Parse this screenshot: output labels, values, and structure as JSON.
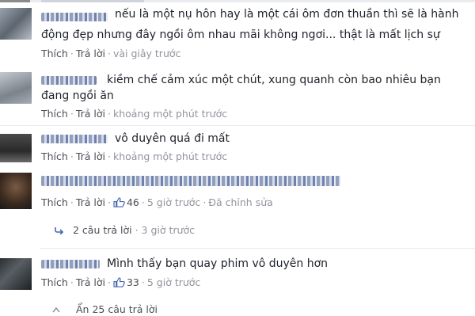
{
  "comments": [
    {
      "text_line1": "nếu là một nụ hôn hay là một cái ôm đơn thuần thì sẽ là hành",
      "text_line2": "động đẹp nhưng đây ngồi ôm nhau mãi không ngơi... thật là mất lịch sự",
      "like": "Thích",
      "reply": "Trả lời",
      "time": "vài giây trước"
    },
    {
      "text_line1": "kiềm chế cảm xúc một chút, xung quanh còn bao nhiêu bạn",
      "text_line2": "đang ngồi ăn",
      "like": "Thích",
      "reply": "Trả lời",
      "time": "khoảng một phút trước"
    },
    {
      "text_line1": "vô duyên quá đi mất",
      "like": "Thích",
      "reply": "Trả lời",
      "time": "khoảng một phút trước"
    },
    {
      "like": "Thích",
      "reply": "Trả lời",
      "likes": "46",
      "time": "5 giờ trước",
      "edited": "Đã chỉnh sửa"
    },
    {
      "text_line1": "Mình thấy bạn quay phim vô duyên hơn",
      "like": "Thích",
      "reply": "Trả lời",
      "likes": "33",
      "time": "5 giờ trước"
    }
  ],
  "replies_link": {
    "label": "2 câu trả lời",
    "time": "3 giờ trước"
  },
  "hide_link": {
    "label": "Ẩn 25 câu trả lời"
  },
  "colors": {
    "link": "#4b4f56",
    "meta": "#90949c",
    "blue": "#4267b2"
  }
}
